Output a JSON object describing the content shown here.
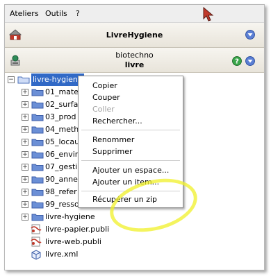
{
  "menubar": {
    "items": [
      {
        "label": "Ateliers"
      },
      {
        "label": "Outils"
      },
      {
        "label": "?"
      }
    ]
  },
  "panel1": {
    "title": "LivreHygiene"
  },
  "panel2": {
    "subtitle": "biotechno",
    "title": "livre"
  },
  "tree": {
    "items": [
      {
        "label": "livre-hygiene",
        "type": "folder",
        "expanded": true,
        "selected": true
      },
      {
        "label": "01_mate",
        "type": "folder"
      },
      {
        "label": "02_surfa",
        "type": "folder"
      },
      {
        "label": "03_prod",
        "type": "folder"
      },
      {
        "label": "04_meth",
        "type": "folder"
      },
      {
        "label": "05_locau",
        "type": "folder"
      },
      {
        "label": "06_envir",
        "type": "folder"
      },
      {
        "label": "07_gesti",
        "type": "folder"
      },
      {
        "label": "90_anne",
        "type": "folder"
      },
      {
        "label": "98_refer",
        "type": "folder"
      },
      {
        "label": "99_resso",
        "type": "folder"
      },
      {
        "label": "livre-hygiene",
        "type": "folder-leaf"
      },
      {
        "label": "livre-papier.publi",
        "type": "publi"
      },
      {
        "label": "livre-web.publi",
        "type": "publi"
      },
      {
        "label": "livre.xml",
        "type": "xml"
      }
    ]
  },
  "context_menu": {
    "items": [
      {
        "label": "Copier",
        "enabled": true
      },
      {
        "label": "Couper",
        "enabled": true
      },
      {
        "label": "Coller",
        "enabled": false
      },
      {
        "label": "Rechercher...",
        "enabled": true
      },
      {
        "label": "Renommer",
        "enabled": true
      },
      {
        "label": "Supprimer",
        "enabled": true
      },
      {
        "label": "Ajouter un espace...",
        "enabled": true
      },
      {
        "label": "Ajouter un item...",
        "enabled": true
      },
      {
        "label": "Récupérer un zip",
        "enabled": true
      }
    ]
  },
  "colors": {
    "selection": "#3169c6",
    "folder": "#6b8fd6",
    "highlight": "#f0f028"
  }
}
